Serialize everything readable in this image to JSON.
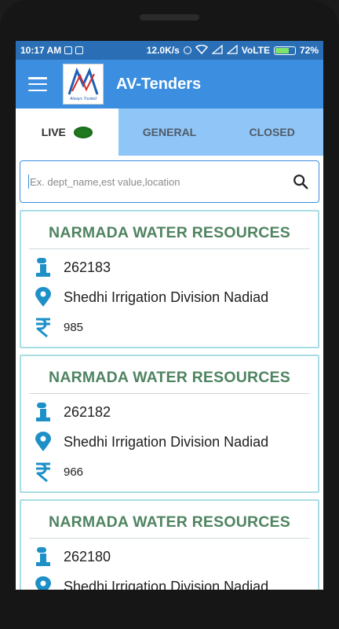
{
  "status_bar": {
    "time": "10:17 AM",
    "network_speed": "12.0K/s",
    "network": "VoLTE",
    "battery_percent": "72%",
    "battery_level": 0.72,
    "battery_color": "#7ee36b"
  },
  "app_bar": {
    "title": "AV-Tenders",
    "logo_tagline": "Always Trusted",
    "menu_icon": "hamburger-menu-icon",
    "color": "#3b8ee0"
  },
  "tabs": [
    {
      "label": "LIVE",
      "active": true,
      "indicator_color": "#1f7a1f"
    },
    {
      "label": "GENERAL",
      "active": false
    },
    {
      "label": "CLOSED",
      "active": false
    }
  ],
  "search": {
    "placeholder": "Ex. dept_name,est value,location",
    "value": "",
    "icon": "search-icon"
  },
  "tenders": [
    {
      "department": "NARMADA WATER RESOURCES",
      "id": "262183",
      "location": "Shedhi Irrigation Division Nadiad",
      "value": "985"
    },
    {
      "department": "NARMADA WATER RESOURCES",
      "id": "262182",
      "location": "Shedhi Irrigation Division Nadiad",
      "value": "966"
    },
    {
      "department": "NARMADA WATER RESOURCES",
      "id": "262180",
      "location": "Shedhi Irrigation Division Nadiad",
      "value": ""
    }
  ],
  "colors": {
    "accent": "#3b8ee0",
    "inactive_tab": "#90c6f7",
    "card_border": "#a9dde4",
    "department_text": "#4f8461",
    "icon": "#1e90c8"
  }
}
